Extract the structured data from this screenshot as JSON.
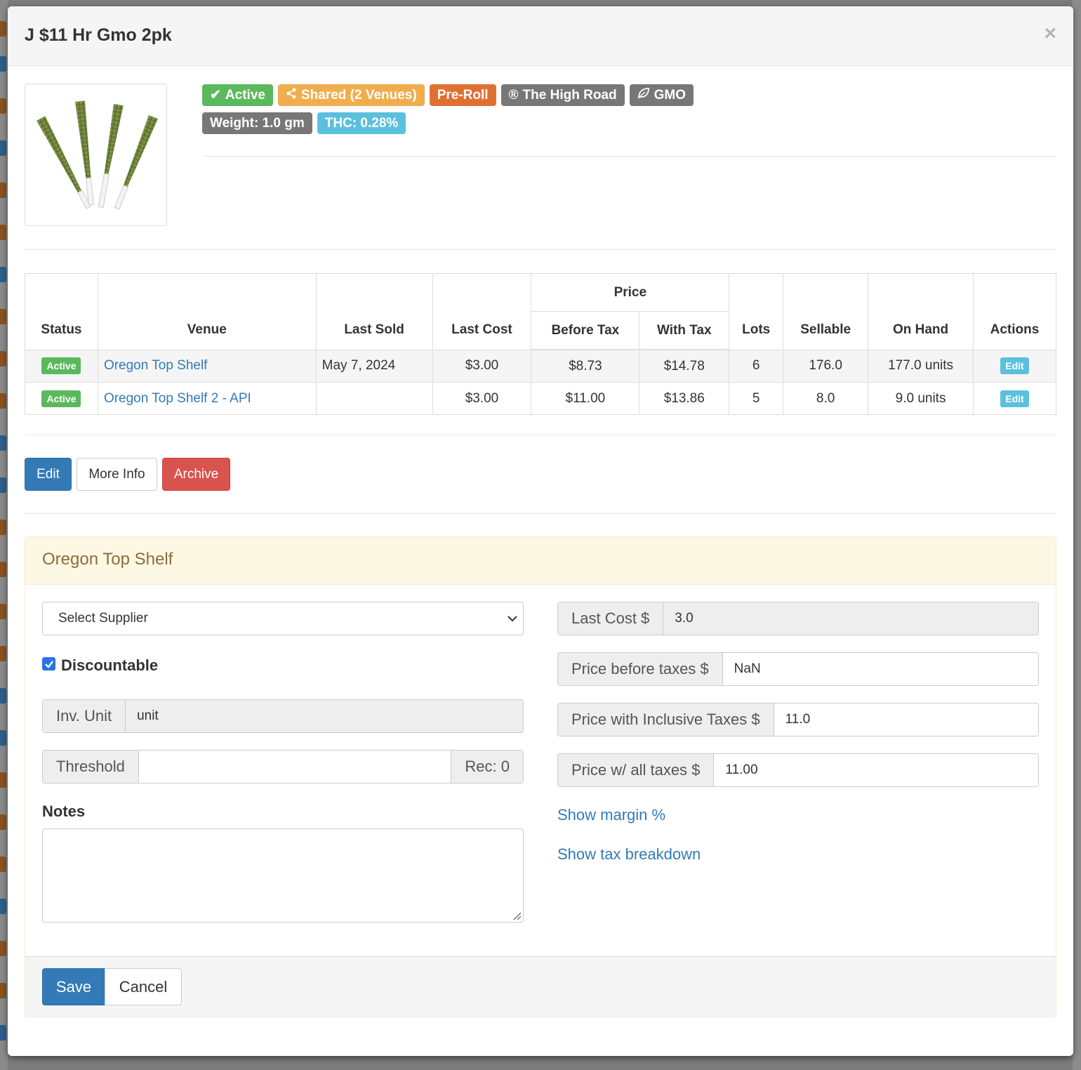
{
  "modal": {
    "title": "J $11 Hr Gmo 2pk",
    "close_glyph": "×"
  },
  "badges": {
    "active": "Active",
    "shared": "Shared (2 Venues)",
    "category": "Pre-Roll",
    "brand": "The High Road",
    "strain": "GMO",
    "weight": "Weight: 1.0 gm",
    "thc": "THC: 0.28%"
  },
  "badge_colors": {
    "active": "#5cb85c",
    "shared": "#f0ad4e",
    "category": "#e07032",
    "brand": "#777777",
    "strain": "#777777",
    "weight": "#777777",
    "thc": "#5bc0de"
  },
  "table": {
    "headers": {
      "status": "Status",
      "venue": "Venue",
      "last_sold": "Last Sold",
      "last_cost": "Last Cost",
      "price": "Price",
      "before_tax": "Before Tax",
      "with_tax": "With Tax",
      "lots": "Lots",
      "sellable": "Sellable",
      "on_hand": "On Hand",
      "actions": "Actions"
    },
    "rows": [
      {
        "status": "Active",
        "venue": "Oregon Top Shelf",
        "last_sold": "May 7, 2024",
        "last_cost": "$3.00",
        "before_tax": "$8.73",
        "with_tax": "$14.78",
        "lots": "6",
        "sellable": "176.0",
        "on_hand": "177.0 units",
        "action": "Edit"
      },
      {
        "status": "Active",
        "venue": "Oregon Top Shelf 2 - API",
        "last_sold": "",
        "last_cost": "$3.00",
        "before_tax": "$11.00",
        "with_tax": "$13.86",
        "lots": "5",
        "sellable": "8.0",
        "on_hand": "9.0 units",
        "action": "Edit"
      }
    ]
  },
  "actions": {
    "edit": "Edit",
    "more_info": "More Info",
    "archive": "Archive"
  },
  "panel": {
    "title": "Oregon Top Shelf",
    "supplier_select": "Select Supplier",
    "discountable_label": "Discountable",
    "discountable_checked": true,
    "inv_unit_label": "Inv. Unit",
    "inv_unit_value": "unit",
    "threshold_label": "Threshold",
    "threshold_value": "",
    "rec_label": "Rec: 0",
    "notes_label": "Notes",
    "notes_value": "",
    "last_cost_label": "Last Cost $",
    "last_cost_value": "3.0",
    "price_before_label": "Price before taxes $",
    "price_before_value": "NaN",
    "price_inclusive_label": "Price with Inclusive Taxes $",
    "price_inclusive_value": "11.0",
    "price_all_label": "Price w/ all taxes $",
    "price_all_value": "11.00",
    "show_margin": "Show margin %",
    "show_tax": "Show tax breakdown",
    "save": "Save",
    "cancel": "Cancel"
  },
  "colors": {
    "primary": "#337ab7",
    "danger": "#d9534f",
    "warning_bg": "#fcf8e3",
    "warning_text": "#8a6d3b"
  }
}
